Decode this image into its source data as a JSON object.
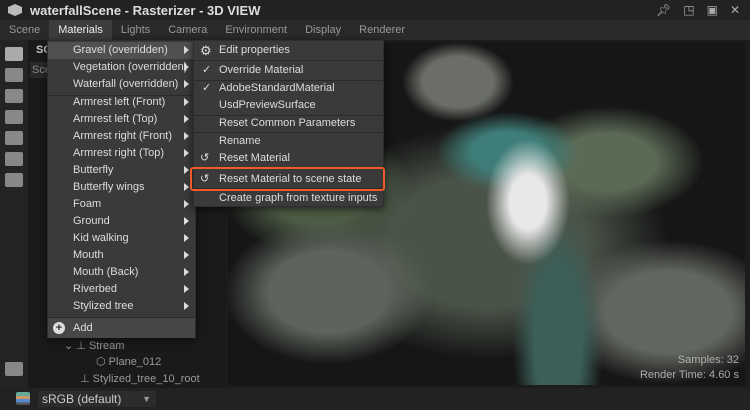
{
  "window": {
    "title": "waterfallScene - Rasterizer - 3D VIEW",
    "controls": [
      "pin",
      "restore",
      "maximize",
      "close"
    ]
  },
  "menubar": [
    "Scene",
    "Materials",
    "Lights",
    "Camera",
    "Environment",
    "Display",
    "Renderer"
  ],
  "panel": {
    "header": "SC",
    "sub": "Sce"
  },
  "materials_menu": {
    "items": [
      "Gravel (overridden)",
      "Vegetation (overridden)",
      "Waterfall (overridden)",
      "Armrest left (Front)",
      "Armrest left (Top)",
      "Armrest right (Front)",
      "Armrest right (Top)",
      "Butterfly",
      "Butterfly wings",
      "Foam",
      "Ground",
      "Kid walking",
      "Mouth",
      "Mouth (Back)",
      "Riverbed",
      "Stylized tree"
    ],
    "add": "Add"
  },
  "submenu": {
    "items": [
      "Edit properties",
      "Override Material",
      "AdobeStandardMaterial",
      "UsdPreviewSurface",
      "Reset Common Parameters",
      "Rename",
      "Reset Material",
      "Reset Material to scene state",
      "Create graph from texture inputs"
    ]
  },
  "tree": [
    {
      "label": "Stream"
    },
    {
      "label": "Plane_012"
    },
    {
      "label": "Stylized_tree_10_root"
    }
  ],
  "viewport": {
    "samples": "Samples: 32",
    "render_time": "Render Time: 4.60 s"
  },
  "bottombar": {
    "colorspace": "sRGB (default)"
  },
  "accent": "#f05a28"
}
